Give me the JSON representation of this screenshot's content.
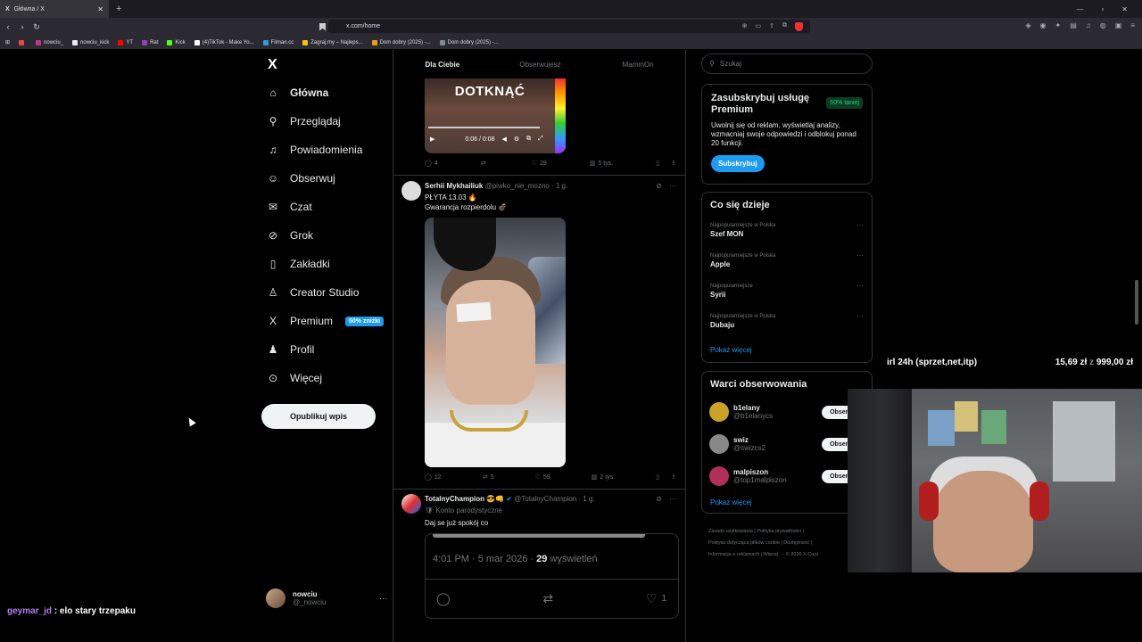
{
  "browser": {
    "tab_title": "Główna / X",
    "url": "x.com/home",
    "bookmarks": [
      {
        "label": "",
        "color": "#e8453c"
      },
      {
        "label": "nowciu_",
        "color": "#c13584"
      },
      {
        "label": "nowciu_kick",
        "color": "#eeeeee"
      },
      {
        "label": "YT",
        "color": "#ff0000"
      },
      {
        "label": "Rat",
        "color": "#8e44ad"
      },
      {
        "label": "Kick",
        "color": "#53fc18"
      },
      {
        "label": "(4)TikTok - Make Yo...",
        "color": "#ffffff"
      },
      {
        "label": "Filman.cc",
        "color": "#3498db"
      },
      {
        "label": "Zagraj.my – Najleps...",
        "color": "#f1c40f"
      },
      {
        "label": "Dom dobry (2025) -...",
        "color": "#f39c12"
      },
      {
        "label": "Dom dobry (2025) -...",
        "color": "#7f8c8d"
      }
    ]
  },
  "nav": {
    "logo": "X",
    "items": [
      {
        "label": "Główna",
        "icon": "home-icon",
        "active": true
      },
      {
        "label": "Przeglądaj",
        "icon": "search-icon"
      },
      {
        "label": "Powiadomienia",
        "icon": "bell-icon"
      },
      {
        "label": "Obserwuj",
        "icon": "follow-icon"
      },
      {
        "label": "Czat",
        "icon": "mail-icon"
      },
      {
        "label": "Grok",
        "icon": "grok-icon"
      },
      {
        "label": "Zakładki",
        "icon": "bookmark-icon"
      },
      {
        "label": "Creator Studio",
        "icon": "creator-icon"
      },
      {
        "label": "Premium",
        "icon": "x-icon",
        "badge": "50% zniżki"
      },
      {
        "label": "Profil",
        "icon": "person-icon"
      },
      {
        "label": "Więcej",
        "icon": "more-icon"
      }
    ],
    "post_button": "Opublikuj wpis",
    "account": {
      "name": "nowciu",
      "handle": "@_nowciu"
    }
  },
  "feed": {
    "tabs": [
      "Dla Ciebie",
      "Obserwujesz",
      "MammOn"
    ],
    "tweet1": {
      "media_text": "DOTKNĄĆ",
      "video_time": "0:06 / 0:08",
      "replies": "4",
      "retweets": "",
      "likes": "28",
      "views": "5 tys."
    },
    "tweet2": {
      "name": "Serhii Mykhailiuk",
      "handle": "@piwko_nie_mozno",
      "time": "· 1 g.",
      "line1": "PŁYTA 13.03 🔥",
      "line2": "Gwarancja rozpierdolu 💣",
      "replies": "12",
      "retweets": "5",
      "likes": "59",
      "views": "2 tys."
    },
    "tweet3": {
      "name": "TotalnyChampion 😎👊",
      "handle": "@TotalnyChampion",
      "time": "· 1 g.",
      "label": "🛡 Konto parodystyczne",
      "text": "Daj se już spokój co",
      "quote_time": "4:01 PM · 5 mar 2026 · ",
      "quote_views_num": "29",
      "quote_views_label": " wyświetleń",
      "quote_likes": "1"
    }
  },
  "right": {
    "search_placeholder": "Szukaj",
    "premium": {
      "title": "Zasubskrybuj usługę Premium",
      "badge": "50% taniej",
      "text": "Uwolnij się od reklam, wyświetlaj analizy, wzmacniaj swoje odpowiedzi i odblokuj ponad 20 funkcji.",
      "button": "Subskrybuj"
    },
    "trends": {
      "title": "Co się dzieje",
      "items": [
        {
          "context": "Najpopularniejsze w Polska",
          "name": "Szef MON"
        },
        {
          "context": "Najpopularniejsze w Polska",
          "name": "Apple"
        },
        {
          "context": "Najpopularniejsze",
          "name": "Syrii"
        },
        {
          "context": "Najpopularniejsze w Polska",
          "name": "Dubaju"
        }
      ],
      "show_more": "Pokaż więcej"
    },
    "follow": {
      "title": "Warci obserwowania",
      "items": [
        {
          "name": "b1elany",
          "handle": "@b1elanycs",
          "button": "Obserwuj",
          "color": "#c9a227"
        },
        {
          "name": "swiz",
          "handle": "@swizcs2",
          "button": "Obserwuj",
          "color": "#888888"
        },
        {
          "name": "malpiszon",
          "handle": "@top1malpiszon",
          "button": "Obserwuj",
          "color": "#b0305a"
        }
      ],
      "show_more": "Pokaż więcej"
    },
    "footer": {
      "line1": "Zasady użytkowania  |  Polityka prywatności  |",
      "line2": "Polityka dotycząca plików cookie  |  Dostępność  |",
      "line3": "Informacja o reklamach  |  Więcej ···  © 2026 X Corp."
    }
  },
  "overlay": {
    "donation_label": "irl 24h (sprzet,net,itp)",
    "donation_amount": "15,69 zł",
    "donation_sep": "z",
    "donation_goal": "999,00 zł",
    "chat_user": "geymar_jd",
    "chat_msg": " : elo stary trzepaku"
  }
}
